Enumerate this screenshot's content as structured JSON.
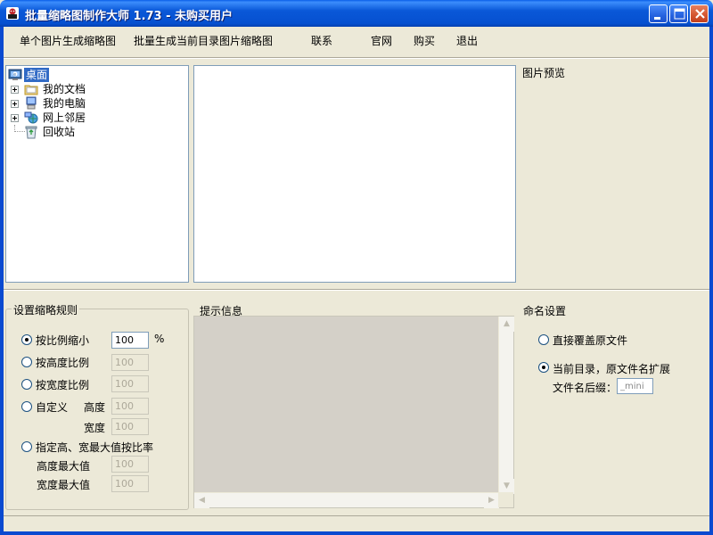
{
  "window": {
    "title": "批量缩略图制作大师 1.73 - 未购买用户"
  },
  "menu": {
    "items": [
      "单个图片生成缩略图",
      "批量生成当前目录图片缩略图",
      "联系",
      "官网",
      "购买",
      "退出"
    ]
  },
  "tree": {
    "root": "桌面",
    "items": [
      "我的文档",
      "我的电脑",
      "网上邻居",
      "回收站"
    ]
  },
  "preview": {
    "title": "图片预览"
  },
  "rules": {
    "title": "设置缩略规则",
    "ratio_label": "按比例缩小",
    "ratio_value": "100",
    "percent_sign": "%",
    "height_ratio_label": "按高度比例",
    "height_ratio_value": "100",
    "width_ratio_label": "按宽度比例",
    "width_ratio_value": "100",
    "custom_label": "自定义",
    "custom_height_label": "高度",
    "custom_height_value": "100",
    "custom_width_label": "宽度",
    "custom_width_value": "100",
    "max_label": "指定高、宽最大值按比率",
    "max_height_label": "高度最大值",
    "max_height_value": "100",
    "max_width_label": "宽度最大值",
    "max_width_value": "100",
    "selected": "ratio"
  },
  "info": {
    "title": "提示信息"
  },
  "naming": {
    "title": "命名设置",
    "overwrite_label": "直接覆盖原文件",
    "current_dir_label": "当前目录，原文件名扩展",
    "suffix_label": "文件名后缀：",
    "suffix_value": "_mini",
    "selected": "current_dir"
  },
  "colors": {
    "titlebar": "#0a5fe8",
    "face": "#ece9d8",
    "selection": "#316ac5"
  }
}
